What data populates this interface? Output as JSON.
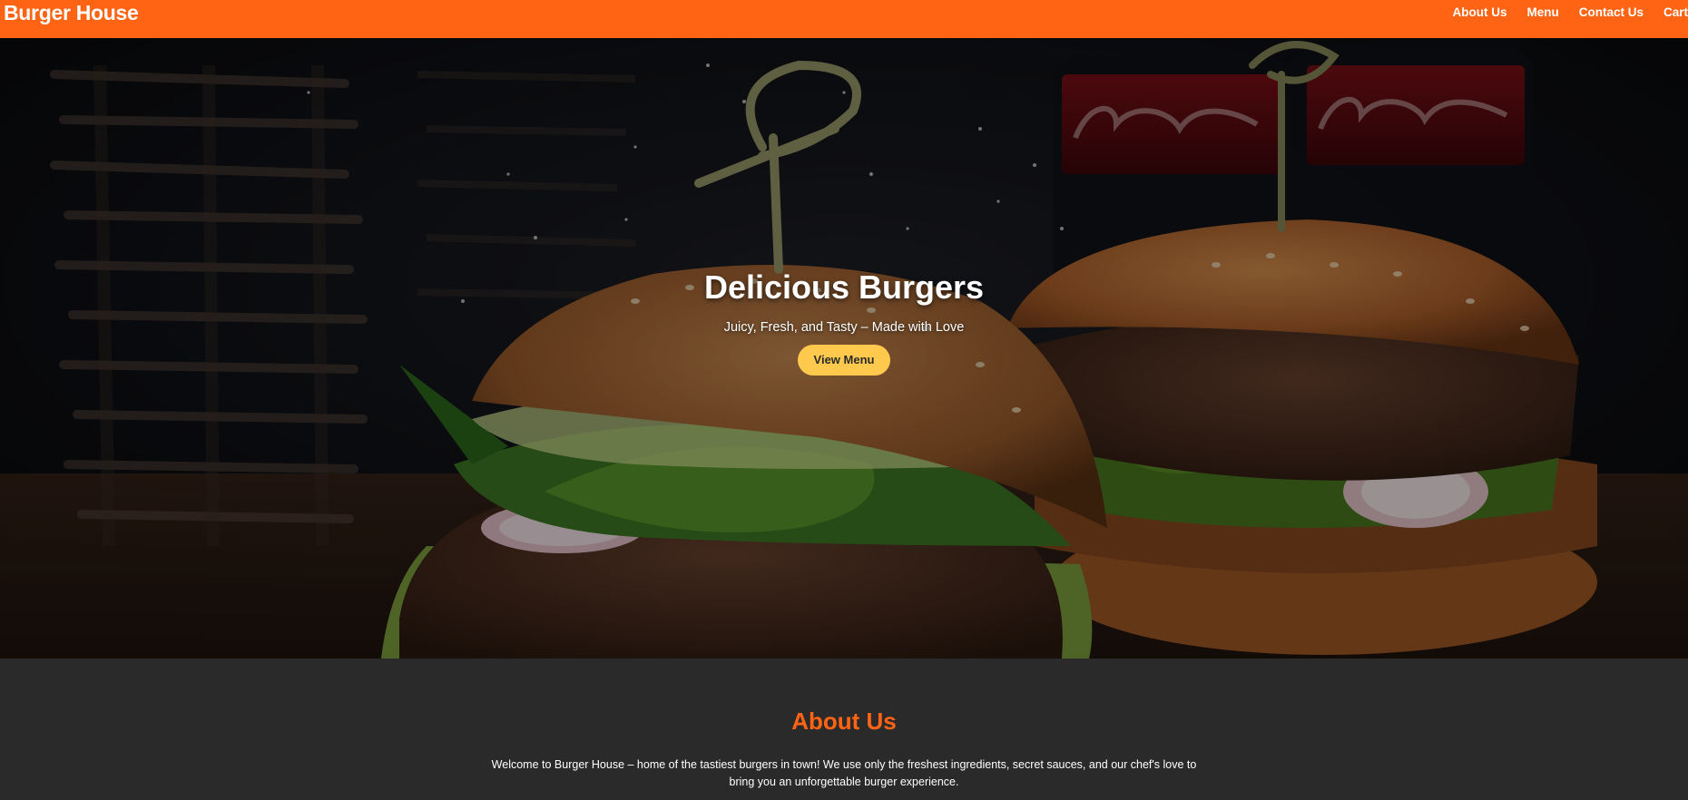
{
  "header": {
    "brand": "Burger House",
    "nav": [
      {
        "label": "About Us"
      },
      {
        "label": "Menu"
      },
      {
        "label": "Contact Us"
      },
      {
        "label": "Cart"
      }
    ]
  },
  "hero": {
    "title": "Delicious Burgers",
    "subtitle": "Juicy, Fresh, and Tasty – Made with Love",
    "button_label": "View Menu"
  },
  "about": {
    "title": "About Us",
    "text": "Welcome to Burger House – home of the tastiest burgers in town! We use only the freshest ingredients, secret sauces, and our chef's love to bring you an unforgettable burger experience."
  },
  "colors": {
    "brand_orange": "#ff6414",
    "button_yellow": "#ffc94d",
    "section_dark": "#2a2a2a"
  }
}
